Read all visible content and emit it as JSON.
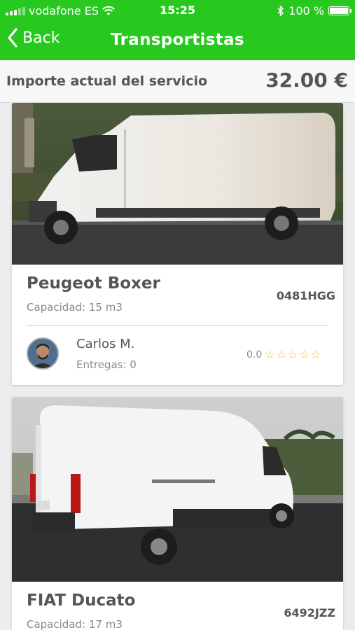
{
  "status_bar": {
    "carrier": "vodafone ES",
    "time": "15:25",
    "battery": "100 %"
  },
  "nav": {
    "back_label": "Back",
    "title": "Transportistas"
  },
  "amount": {
    "label": "Importe actual del servicio",
    "value": "32.00 €"
  },
  "carriers": [
    {
      "vehicle": "Peugeot Boxer",
      "capacity": "Capacidad: 15 m3",
      "plate": "0481HGG",
      "driver": {
        "name": "Carlos M.",
        "deliveries": "Entregas: 0",
        "rating": "0.0",
        "stars": 0
      }
    },
    {
      "vehicle": "FIAT Ducato",
      "capacity": "Capacidad: 17 m3",
      "plate": "6492JZZ"
    }
  ],
  "colors": {
    "brand_green": "#27c91f",
    "star": "#f2b31d"
  }
}
